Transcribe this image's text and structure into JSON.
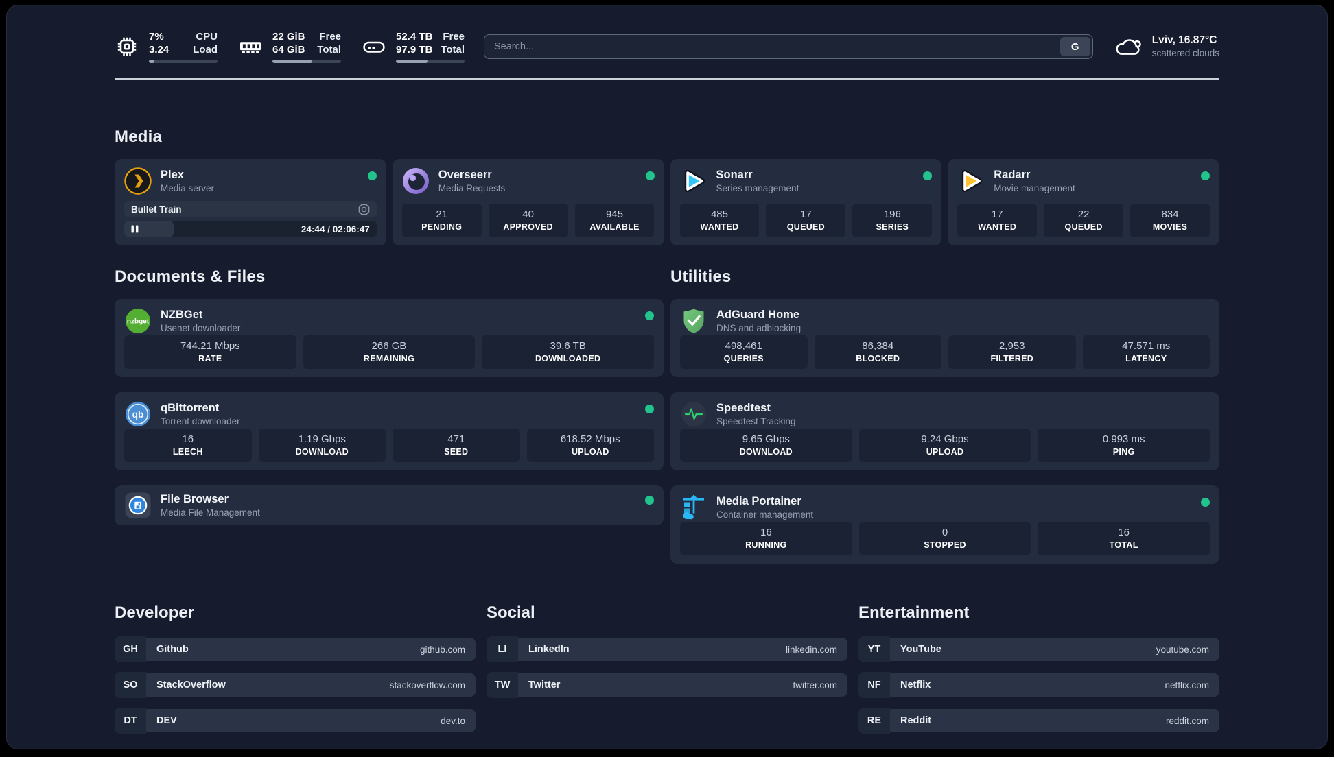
{
  "topbar": {
    "stats": [
      {
        "icon": "cpu-icon",
        "value_top": "7%",
        "value_bottom": "3.24",
        "label_top": "CPU",
        "label_bottom": "Load",
        "progress_pct": 8
      },
      {
        "icon": "ram-icon",
        "value_top": "22 GiB",
        "value_bottom": "64 GiB",
        "label_top": "Free",
        "label_bottom": "Total",
        "progress_pct": 58
      },
      {
        "icon": "disk-icon",
        "value_top": "52.4 TB",
        "value_bottom": "97.9 TB",
        "label_top": "Free",
        "label_bottom": "Total",
        "progress_pct": 46
      }
    ],
    "search": {
      "placeholder": "Search...",
      "provider_label": "G"
    },
    "weather": {
      "icon": "cloud-icon",
      "location_temp": "Lviv, 16.87°C",
      "condition": "scattered clouds"
    }
  },
  "sections": {
    "media": {
      "title": "Media",
      "apps": [
        {
          "name": "Plex",
          "subtitle": "Media server",
          "icon": "plex-icon",
          "online": true,
          "now_playing": {
            "title": "Bullet Train",
            "time": "24:44 / 02:06:47",
            "elapsed": "24:44",
            "duration": "02:06:47",
            "progress_pct": 19.5
          }
        },
        {
          "name": "Overseerr",
          "subtitle": "Media Requests",
          "icon": "overseerr-icon",
          "online": true,
          "stats": [
            {
              "value": "21",
              "label": "PENDING"
            },
            {
              "value": "40",
              "label": "APPROVED"
            },
            {
              "value": "945",
              "label": "AVAILABLE"
            }
          ]
        },
        {
          "name": "Sonarr",
          "subtitle": "Series management",
          "icon": "sonarr-icon",
          "online": true,
          "stats": [
            {
              "value": "485",
              "label": "WANTED"
            },
            {
              "value": "17",
              "label": "QUEUED"
            },
            {
              "value": "196",
              "label": "SERIES"
            }
          ]
        },
        {
          "name": "Radarr",
          "subtitle": "Movie management",
          "icon": "radarr-icon",
          "online": true,
          "stats": [
            {
              "value": "17",
              "label": "WANTED"
            },
            {
              "value": "22",
              "label": "QUEUED"
            },
            {
              "value": "834",
              "label": "MOVIES"
            }
          ]
        }
      ]
    },
    "documents": {
      "title": "Documents & Files",
      "apps": [
        {
          "name": "NZBGet",
          "subtitle": "Usenet downloader",
          "icon": "nzbget-icon",
          "online": true,
          "stats": [
            {
              "value": "744.21 Mbps",
              "label": "RATE"
            },
            {
              "value": "266 GB",
              "label": "REMAINING"
            },
            {
              "value": "39.6 TB",
              "label": "DOWNLOADED"
            }
          ]
        },
        {
          "name": "qBittorrent",
          "subtitle": "Torrent downloader",
          "icon": "qbittorrent-icon",
          "online": true,
          "stats": [
            {
              "value": "16",
              "label": "LEECH"
            },
            {
              "value": "1.19 Gbps",
              "label": "DOWNLOAD"
            },
            {
              "value": "471",
              "label": "SEED"
            },
            {
              "value": "618.52 Mbps",
              "label": "UPLOAD"
            }
          ]
        },
        {
          "name": "File Browser",
          "subtitle": "Media File Management",
          "icon": "filebrowser-icon",
          "online": true
        }
      ]
    },
    "utilities": {
      "title": "Utilities",
      "apps": [
        {
          "name": "AdGuard Home",
          "subtitle": "DNS and adblocking",
          "icon": "adguard-icon",
          "online": false,
          "stats": [
            {
              "value": "498,461",
              "label": "QUERIES"
            },
            {
              "value": "86,384",
              "label": "BLOCKED"
            },
            {
              "value": "2,953",
              "label": "FILTERED"
            },
            {
              "value": "47.571 ms",
              "label": "LATENCY"
            }
          ]
        },
        {
          "name": "Speedtest",
          "subtitle": "Speedtest Tracking",
          "icon": "speedtest-icon",
          "online": false,
          "stats": [
            {
              "value": "9.65 Gbps",
              "label": "DOWNLOAD"
            },
            {
              "value": "9.24 Gbps",
              "label": "UPLOAD"
            },
            {
              "value": "0.993 ms",
              "label": "PING"
            }
          ]
        },
        {
          "name": "Media Portainer",
          "subtitle": "Container management",
          "icon": "portainer-icon",
          "online": true,
          "stats": [
            {
              "value": "16",
              "label": "RUNNING"
            },
            {
              "value": "0",
              "label": "STOPPED"
            },
            {
              "value": "16",
              "label": "TOTAL"
            }
          ]
        }
      ]
    },
    "bookmarks": [
      {
        "title": "Developer",
        "links": [
          {
            "abbr": "GH",
            "name": "Github",
            "url": "github.com"
          },
          {
            "abbr": "SO",
            "name": "StackOverflow",
            "url": "stackoverflow.com"
          },
          {
            "abbr": "DT",
            "name": "DEV",
            "url": "dev.to"
          }
        ]
      },
      {
        "title": "Social",
        "links": [
          {
            "abbr": "LI",
            "name": "LinkedIn",
            "url": "linkedin.com"
          },
          {
            "abbr": "TW",
            "name": "Twitter",
            "url": "twitter.com"
          }
        ]
      },
      {
        "title": "Entertainment",
        "links": [
          {
            "abbr": "YT",
            "name": "YouTube",
            "url": "youtube.com"
          },
          {
            "abbr": "NF",
            "name": "Netflix",
            "url": "netflix.com"
          },
          {
            "abbr": "RE",
            "name": "Reddit",
            "url": "reddit.com"
          }
        ]
      }
    ]
  },
  "colors": {
    "page_bg": "#161c2d",
    "card_bg": "#242d3f",
    "tile_bg": "#1b2233",
    "status_online": "#22c38c",
    "text_primary": "#f3f5f9",
    "text_secondary": "#98a1b3",
    "plex_amber": "#e5a00d",
    "sonarr_cyan": "#35c5f4",
    "radarr_amber": "#ffc230",
    "nzbget_green": "#54ae32",
    "qbittorrent_blue": "#4a8fd4",
    "adguard_green": "#67b279",
    "speedtest_green": "#2ecc71",
    "portainer_blue": "#29b8f5",
    "overseerr_purple": "#8a6fd8"
  }
}
